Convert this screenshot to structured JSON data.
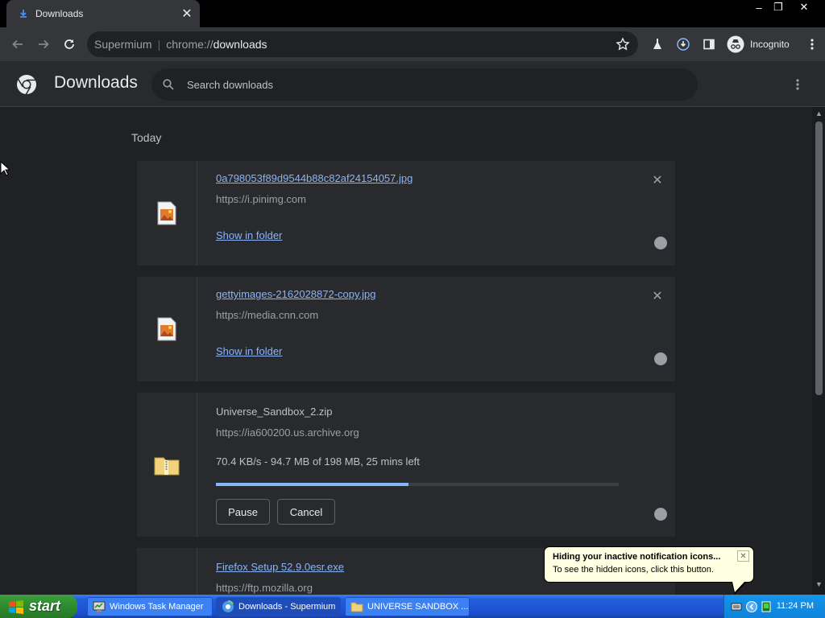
{
  "window": {
    "tab_title": "Downloads",
    "minimize": "–",
    "restore": "❐",
    "close": "✕"
  },
  "toolbar": {
    "omnibox_host": "Supermium",
    "omnibox_scheme": "chrome://",
    "omnibox_path": "downloads",
    "profile_label": "Incognito"
  },
  "header": {
    "title": "Downloads",
    "search_placeholder": "Search downloads"
  },
  "downloads": {
    "section_label": "Today",
    "items": [
      {
        "filename": "0a798053f89d9544b88c82af24154057.jpg",
        "source": "https://i.pinimg.com",
        "action": "Show in folder"
      },
      {
        "filename": "gettyimages-2162028872-copy.jpg",
        "source": "https://media.cnn.com",
        "action": "Show in folder"
      },
      {
        "filename": "Universe_Sandbox_2.zip",
        "source": "https://ia600200.us.archive.org",
        "status": "70.4 KB/s - 94.7 MB of 198 MB, 25 mins left",
        "progress": 0.478,
        "pause_label": "Pause",
        "cancel_label": "Cancel"
      },
      {
        "filename": "Firefox Setup 52.9.0esr.exe",
        "source": "https://ftp.mozilla.org"
      }
    ]
  },
  "taskbar": {
    "start_label": "start",
    "items": [
      {
        "label": "Windows Task Manager"
      },
      {
        "label": "Downloads - Supermium"
      },
      {
        "label": "UNIVERSE SANDBOX ..."
      }
    ],
    "clock": "11:24 PM"
  },
  "balloon": {
    "title": "Hiding your inactive notification icons...",
    "body": "To see the hidden icons, click this button."
  },
  "colors": {
    "accent": "#8ab4f8",
    "page_bg": "#202124",
    "card_bg": "#292a2d",
    "toolbar_bg": "#35363a"
  }
}
